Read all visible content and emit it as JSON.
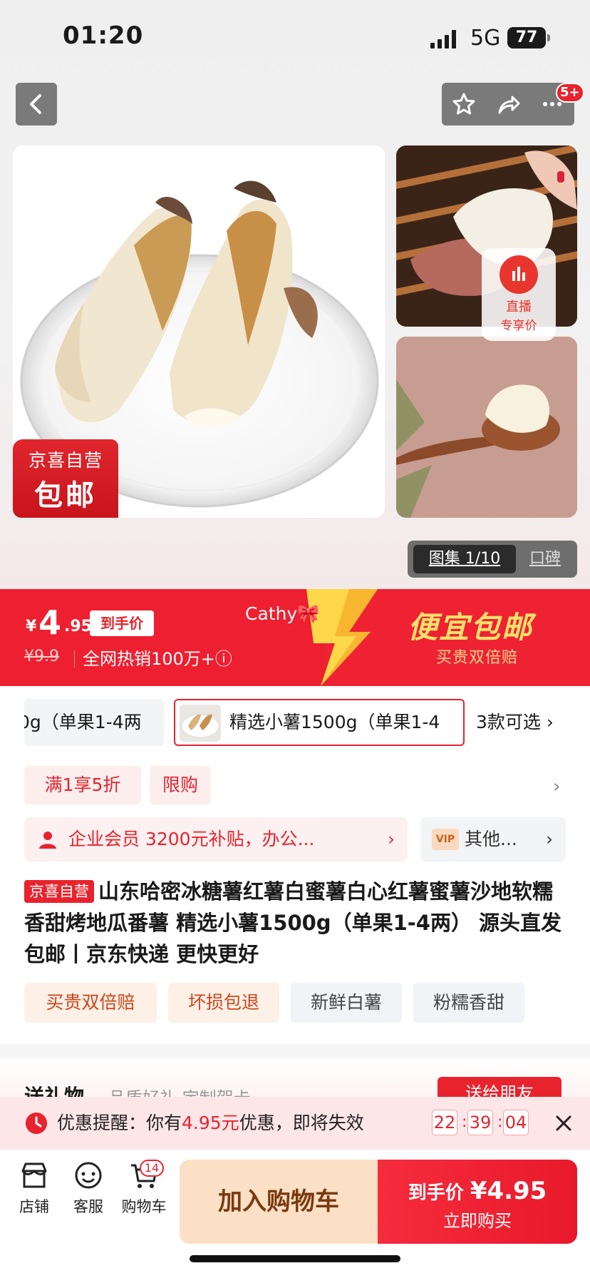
{
  "status_bar": {
    "time": "01:20",
    "network": "5G",
    "battery": "77"
  },
  "header": {
    "more_badge": "5+"
  },
  "gallery": {
    "stamp_line1": "京喜自营",
    "stamp_line2": "包邮",
    "live_line1": "直播",
    "live_line2": "专享价",
    "tab_album": "图集 1/10",
    "tab_review": "口碑"
  },
  "price_banner": {
    "currency": "¥",
    "price_int": "4",
    "price_dec": ".95",
    "hand_price_tag": "到手价",
    "original_price": "¥9.9",
    "hot_sales": "全网热销100万+ⓘ",
    "watermark": "Cathy🎀",
    "slogan": "便宜包邮",
    "slogan_sub": "买贵双倍赔"
  },
  "sku": {
    "option1": "0g（单果1-4两",
    "option2": "精选小薯1500g（单果1-4",
    "count": "3款可选 ›"
  },
  "promotions": {
    "discount": "满1享5折",
    "limited": "限购",
    "arrow": "›"
  },
  "member": {
    "text": "企业会员 3200元补贴，办公...",
    "arrow": "›",
    "vip_label": "VIP",
    "vip_text": "其他...",
    "vip_arrow": "›"
  },
  "product": {
    "badge": "京喜自营",
    "title": "山东哈密冰糖薯红薯白蜜薯白心红薯蜜薯沙地软糯香甜烤地瓜番薯 精选小薯1500g（单果1-4两） 源头直发包邮丨京东快递 更快更好",
    "tags": [
      "买贵双倍赔",
      "坏损包退",
      "新鲜白薯",
      "粉糯香甜"
    ]
  },
  "gift": {
    "title": "送礼物",
    "subtitle": "品质好礼 定制贺卡",
    "button": "送给朋友"
  },
  "reminder": {
    "prefix": "优惠提醒：你有",
    "amount": "4.95元",
    "suffix": "优惠，即将失效",
    "hh": "22",
    "mm": "39",
    "ss": "04"
  },
  "bottom_bar": {
    "shop": "店铺",
    "service": "客服",
    "cart": "购物车",
    "cart_count": "14",
    "add_to_cart": "加入购物车",
    "buy_label": "到手价",
    "buy_price": "¥4.95",
    "buy_now": "立即购买"
  },
  "colors": {
    "brand_red": "#e8232d",
    "banner_yellow": "#ffe26b",
    "cart_bg": "#fbe0c6"
  }
}
